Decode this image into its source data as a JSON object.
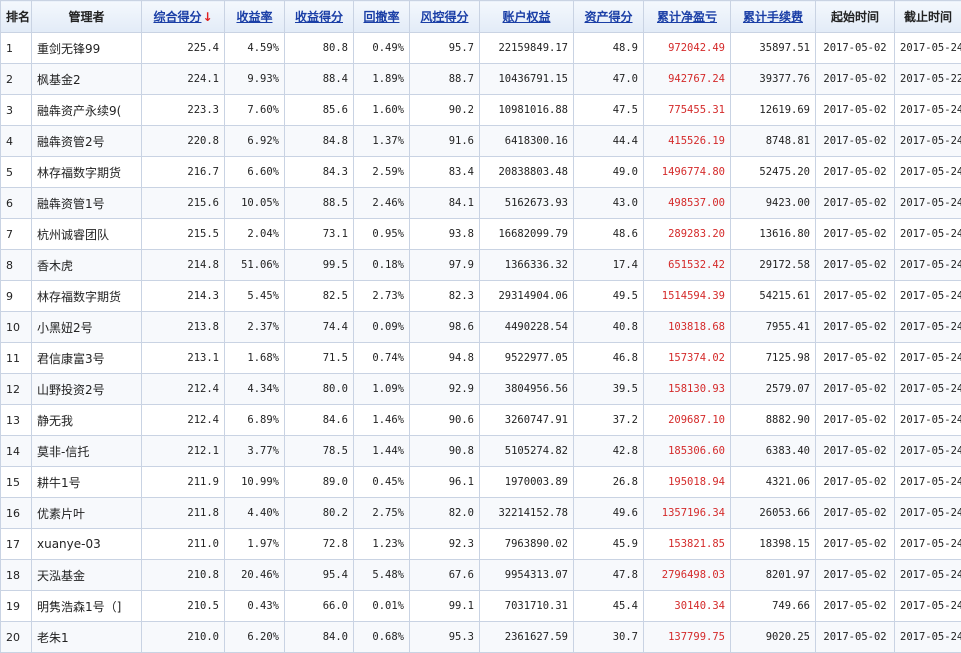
{
  "colors": {
    "header_link": "#1a3ea6",
    "sort_arrow": "#e02020",
    "negative_value": "#d42a2a",
    "border": "#c9d3e3"
  },
  "columns": [
    {
      "label": "排名",
      "sortable": false
    },
    {
      "label": "管理者",
      "sortable": false
    },
    {
      "label": "综合得分",
      "sortable": true,
      "sorted": true,
      "sort_arrow": "↓"
    },
    {
      "label": "收益率",
      "sortable": true
    },
    {
      "label": "收益得分",
      "sortable": true
    },
    {
      "label": "回撤率",
      "sortable": true
    },
    {
      "label": "风控得分",
      "sortable": true
    },
    {
      "label": "账户权益",
      "sortable": true
    },
    {
      "label": "资产得分",
      "sortable": true
    },
    {
      "label": "累计净盈亏",
      "sortable": true
    },
    {
      "label": "累计手续费",
      "sortable": true
    },
    {
      "label": "起始时间",
      "sortable": false
    },
    {
      "label": "截止时间",
      "sortable": false
    }
  ],
  "rows": [
    {
      "rank": "1",
      "manager": "重剑无锋99",
      "score": "225.4",
      "return_rate": "4.59%",
      "return_score": "80.8",
      "drawdown": "0.49%",
      "risk_score": "95.7",
      "equity": "22159849.17",
      "asset_score": "48.9",
      "net_pnl": "972042.49",
      "fees": "35897.51",
      "start": "2017-05-02",
      "end": "2017-05-24"
    },
    {
      "rank": "2",
      "manager": "枫基金2",
      "score": "224.1",
      "return_rate": "9.93%",
      "return_score": "88.4",
      "drawdown": "1.89%",
      "risk_score": "88.7",
      "equity": "10436791.15",
      "asset_score": "47.0",
      "net_pnl": "942767.24",
      "fees": "39377.76",
      "start": "2017-05-02",
      "end": "2017-05-22"
    },
    {
      "rank": "3",
      "manager": "融犇资产永续9(",
      "score": "223.3",
      "return_rate": "7.60%",
      "return_score": "85.6",
      "drawdown": "1.60%",
      "risk_score": "90.2",
      "equity": "10981016.88",
      "asset_score": "47.5",
      "net_pnl": "775455.31",
      "fees": "12619.69",
      "start": "2017-05-02",
      "end": "2017-05-24"
    },
    {
      "rank": "4",
      "manager": "融犇资管2号",
      "score": "220.8",
      "return_rate": "6.92%",
      "return_score": "84.8",
      "drawdown": "1.37%",
      "risk_score": "91.6",
      "equity": "6418300.16",
      "asset_score": "44.4",
      "net_pnl": "415526.19",
      "fees": "8748.81",
      "start": "2017-05-02",
      "end": "2017-05-24"
    },
    {
      "rank": "5",
      "manager": "林存福数字期货",
      "score": "216.7",
      "return_rate": "6.60%",
      "return_score": "84.3",
      "drawdown": "2.59%",
      "risk_score": "83.4",
      "equity": "20838803.48",
      "asset_score": "49.0",
      "net_pnl": "1496774.80",
      "fees": "52475.20",
      "start": "2017-05-02",
      "end": "2017-05-24"
    },
    {
      "rank": "6",
      "manager": "融犇资管1号",
      "score": "215.6",
      "return_rate": "10.05%",
      "return_score": "88.5",
      "drawdown": "2.46%",
      "risk_score": "84.1",
      "equity": "5162673.93",
      "asset_score": "43.0",
      "net_pnl": "498537.00",
      "fees": "9423.00",
      "start": "2017-05-02",
      "end": "2017-05-24"
    },
    {
      "rank": "7",
      "manager": "杭州诚睿团队",
      "score": "215.5",
      "return_rate": "2.04%",
      "return_score": "73.1",
      "drawdown": "0.95%",
      "risk_score": "93.8",
      "equity": "16682099.79",
      "asset_score": "48.6",
      "net_pnl": "289283.20",
      "fees": "13616.80",
      "start": "2017-05-02",
      "end": "2017-05-24"
    },
    {
      "rank": "8",
      "manager": "香木虎",
      "score": "214.8",
      "return_rate": "51.06%",
      "return_score": "99.5",
      "drawdown": "0.18%",
      "risk_score": "97.9",
      "equity": "1366336.32",
      "asset_score": "17.4",
      "net_pnl": "651532.42",
      "fees": "29172.58",
      "start": "2017-05-02",
      "end": "2017-05-24"
    },
    {
      "rank": "9",
      "manager": "林存福数字期货",
      "score": "214.3",
      "return_rate": "5.45%",
      "return_score": "82.5",
      "drawdown": "2.73%",
      "risk_score": "82.3",
      "equity": "29314904.06",
      "asset_score": "49.5",
      "net_pnl": "1514594.39",
      "fees": "54215.61",
      "start": "2017-05-02",
      "end": "2017-05-24"
    },
    {
      "rank": "10",
      "manager": "小黑妞2号",
      "score": "213.8",
      "return_rate": "2.37%",
      "return_score": "74.4",
      "drawdown": "0.09%",
      "risk_score": "98.6",
      "equity": "4490228.54",
      "asset_score": "40.8",
      "net_pnl": "103818.68",
      "fees": "7955.41",
      "start": "2017-05-02",
      "end": "2017-05-24"
    },
    {
      "rank": "11",
      "manager": "君信康富3号",
      "score": "213.1",
      "return_rate": "1.68%",
      "return_score": "71.5",
      "drawdown": "0.74%",
      "risk_score": "94.8",
      "equity": "9522977.05",
      "asset_score": "46.8",
      "net_pnl": "157374.02",
      "fees": "7125.98",
      "start": "2017-05-02",
      "end": "2017-05-24"
    },
    {
      "rank": "12",
      "manager": "山野投资2号",
      "score": "212.4",
      "return_rate": "4.34%",
      "return_score": "80.0",
      "drawdown": "1.09%",
      "risk_score": "92.9",
      "equity": "3804956.56",
      "asset_score": "39.5",
      "net_pnl": "158130.93",
      "fees": "2579.07",
      "start": "2017-05-02",
      "end": "2017-05-24"
    },
    {
      "rank": "13",
      "manager": "静无我",
      "score": "212.4",
      "return_rate": "6.89%",
      "return_score": "84.6",
      "drawdown": "1.46%",
      "risk_score": "90.6",
      "equity": "3260747.91",
      "asset_score": "37.2",
      "net_pnl": "209687.10",
      "fees": "8882.90",
      "start": "2017-05-02",
      "end": "2017-05-24"
    },
    {
      "rank": "14",
      "manager": "莫非-信托",
      "score": "212.1",
      "return_rate": "3.77%",
      "return_score": "78.5",
      "drawdown": "1.44%",
      "risk_score": "90.8",
      "equity": "5105274.82",
      "asset_score": "42.8",
      "net_pnl": "185306.60",
      "fees": "6383.40",
      "start": "2017-05-02",
      "end": "2017-05-24"
    },
    {
      "rank": "15",
      "manager": "耕牛1号",
      "score": "211.9",
      "return_rate": "10.99%",
      "return_score": "89.0",
      "drawdown": "0.45%",
      "risk_score": "96.1",
      "equity": "1970003.89",
      "asset_score": "26.8",
      "net_pnl": "195018.94",
      "fees": "4321.06",
      "start": "2017-05-02",
      "end": "2017-05-24"
    },
    {
      "rank": "16",
      "manager": "优素片叶",
      "score": "211.8",
      "return_rate": "4.40%",
      "return_score": "80.2",
      "drawdown": "2.75%",
      "risk_score": "82.0",
      "equity": "32214152.78",
      "asset_score": "49.6",
      "net_pnl": "1357196.34",
      "fees": "26053.66",
      "start": "2017-05-02",
      "end": "2017-05-24"
    },
    {
      "rank": "17",
      "manager": "xuanye-03",
      "score": "211.0",
      "return_rate": "1.97%",
      "return_score": "72.8",
      "drawdown": "1.23%",
      "risk_score": "92.3",
      "equity": "7963890.02",
      "asset_score": "45.9",
      "net_pnl": "153821.85",
      "fees": "18398.15",
      "start": "2017-05-02",
      "end": "2017-05-24"
    },
    {
      "rank": "18",
      "manager": "天泓基金",
      "score": "210.8",
      "return_rate": "20.46%",
      "return_score": "95.4",
      "drawdown": "5.48%",
      "risk_score": "67.6",
      "equity": "9954313.07",
      "asset_score": "47.8",
      "net_pnl": "2796498.03",
      "fees": "8201.97",
      "start": "2017-05-02",
      "end": "2017-05-24"
    },
    {
      "rank": "19",
      "manager": "明隽浩森1号（]",
      "score": "210.5",
      "return_rate": "0.43%",
      "return_score": "66.0",
      "drawdown": "0.01%",
      "risk_score": "99.1",
      "equity": "7031710.31",
      "asset_score": "45.4",
      "net_pnl": "30140.34",
      "fees": "749.66",
      "start": "2017-05-02",
      "end": "2017-05-24"
    },
    {
      "rank": "20",
      "manager": "老朱1",
      "score": "210.0",
      "return_rate": "6.20%",
      "return_score": "84.0",
      "drawdown": "0.68%",
      "risk_score": "95.3",
      "equity": "2361627.59",
      "asset_score": "30.7",
      "net_pnl": "137799.75",
      "fees": "9020.25",
      "start": "2017-05-02",
      "end": "2017-05-24"
    }
  ]
}
